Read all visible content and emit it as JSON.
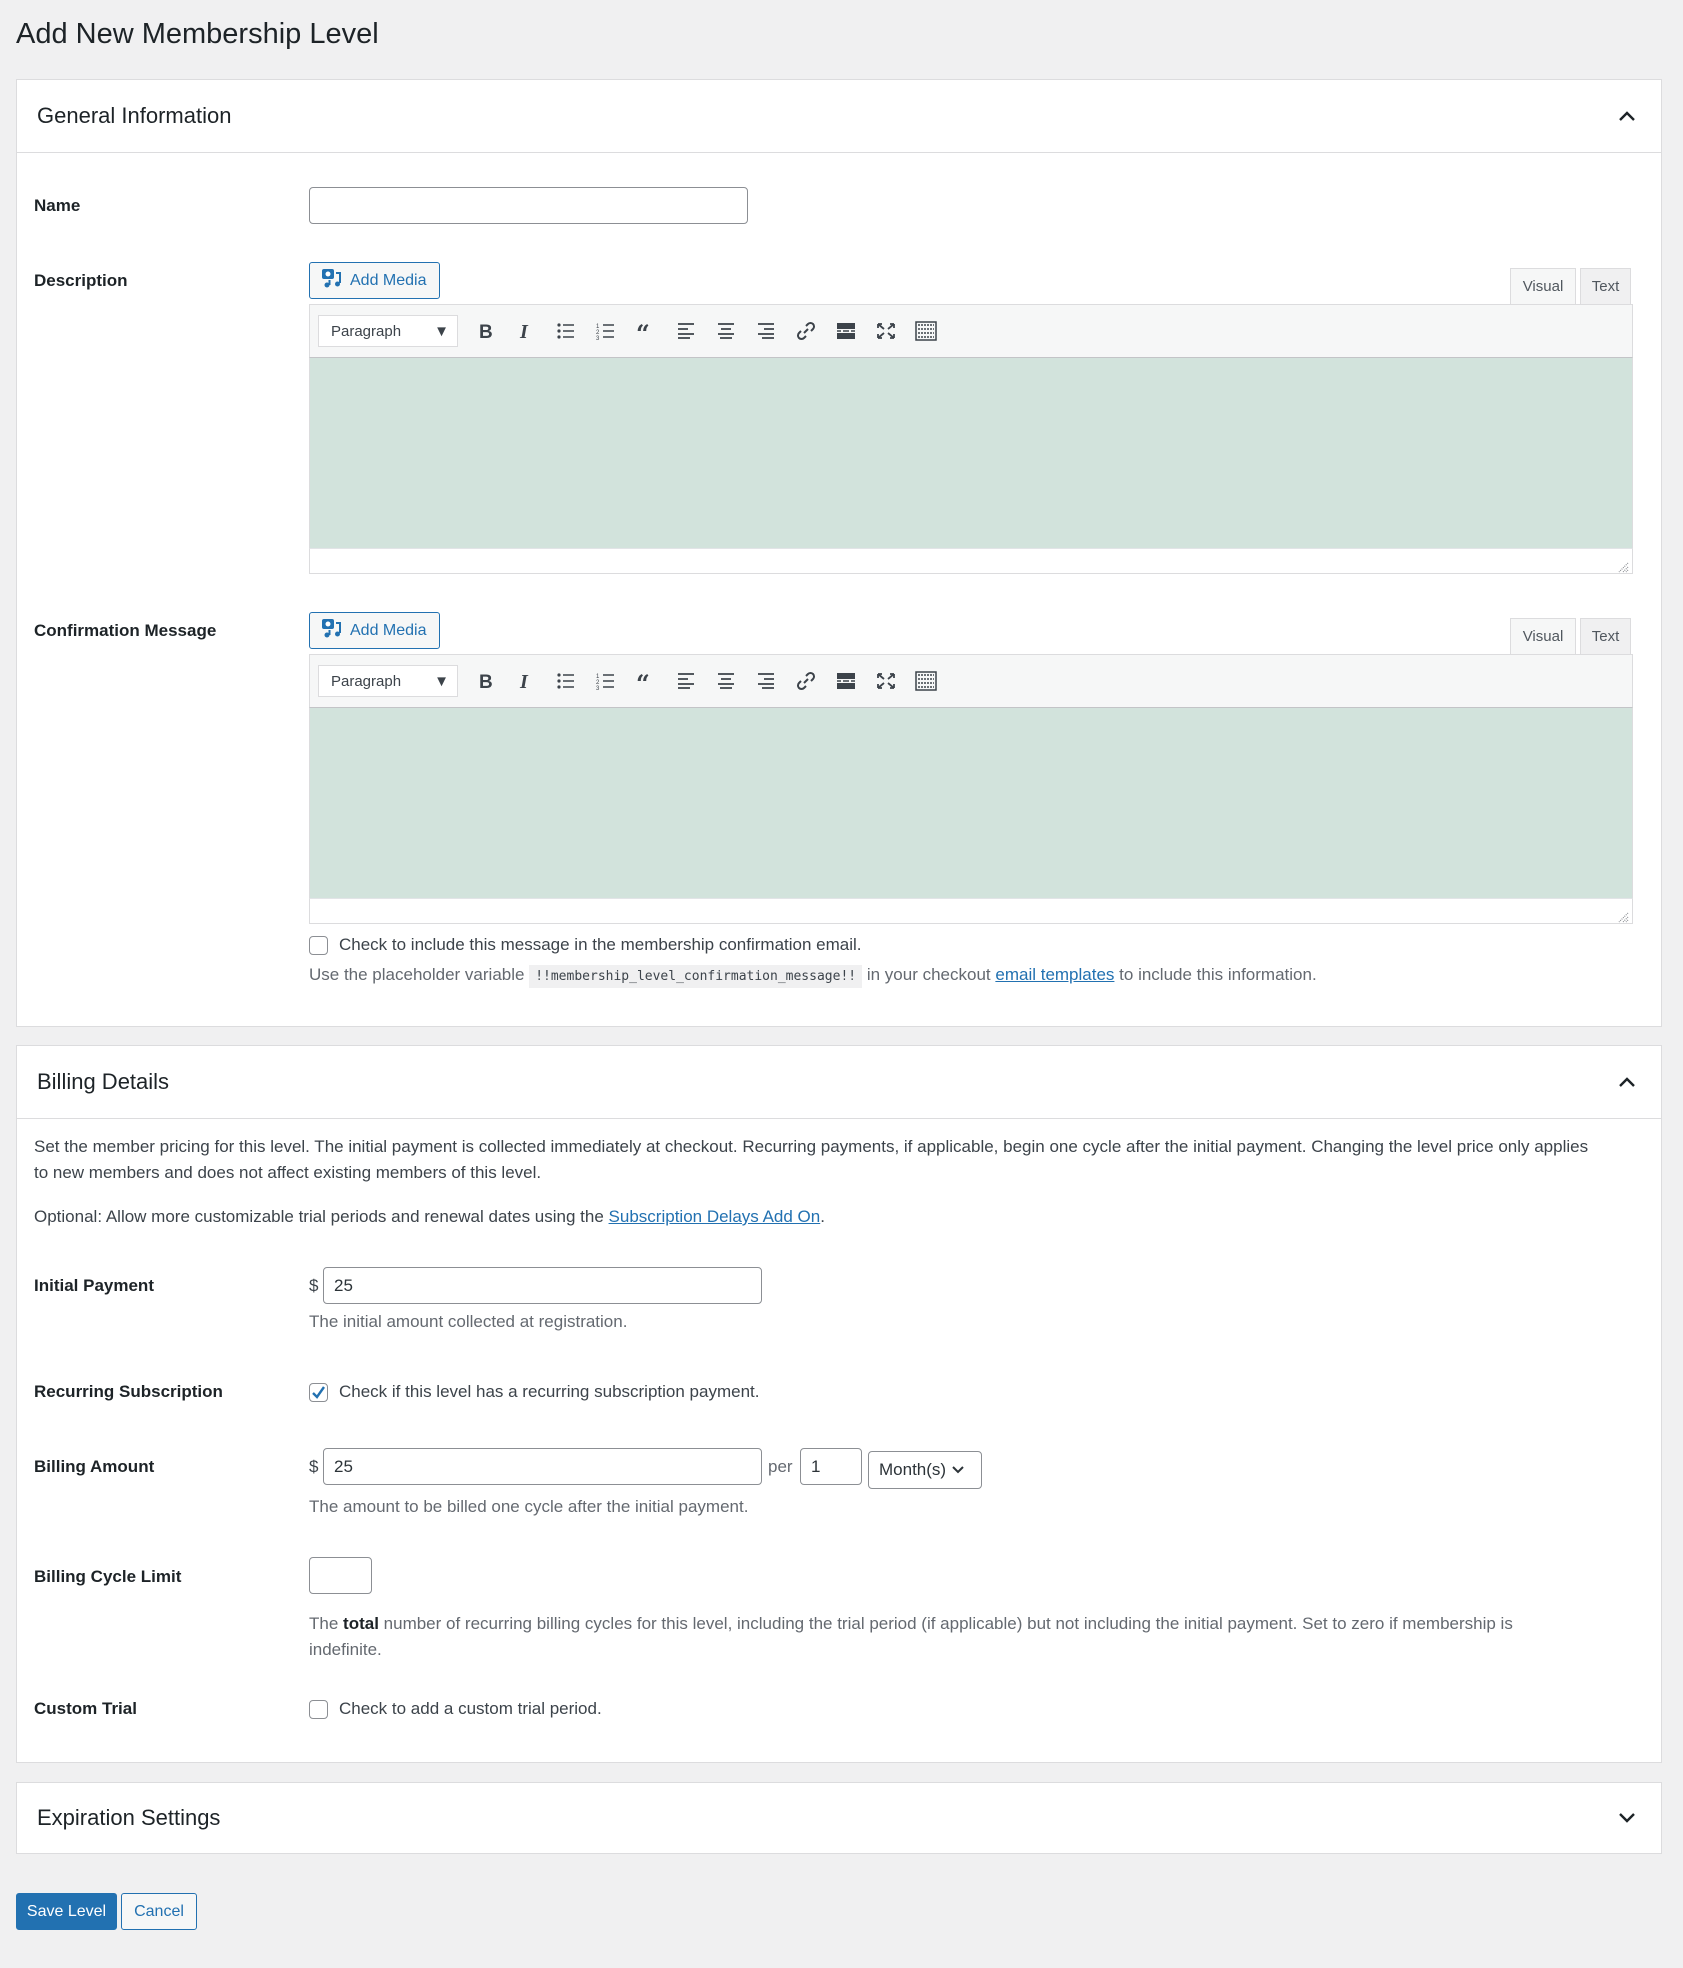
{
  "page": {
    "title": "Add New Membership Level"
  },
  "general": {
    "title": "General Information",
    "name_label": "Name",
    "name_value": "",
    "description_label": "Description",
    "confirmation_label": "Confirmation Message",
    "add_media_label": "Add Media",
    "tab_visual": "Visual",
    "tab_text": "Text",
    "format_select": "Paragraph",
    "toolbar_icons": [
      "bold-icon",
      "italic-icon",
      "bulleted-list-icon",
      "numbered-list-icon",
      "blockquote-icon",
      "align-left-icon",
      "align-center-icon",
      "align-right-icon",
      "link-icon",
      "read-more-icon",
      "fullscreen-icon",
      "toolbar-toggle-icon"
    ],
    "confirm_email_checkbox_label": "Check to include this message in the membership confirmation email.",
    "confirm_email_checked": false,
    "placeholder_prefix": "Use the placeholder variable",
    "placeholder_code": "!!membership_level_confirmation_message!!",
    "placeholder_middle": "in your checkout",
    "placeholder_link": "email templates",
    "placeholder_suffix": "to include this information."
  },
  "billing": {
    "title": "Billing Details",
    "intro_line1": "Set the member pricing for this level. The initial payment is collected immediately at checkout. Recurring payments, if applicable, begin one cycle after the initial payment. Changing the level price only applies",
    "intro_line2": "to new members and does not affect existing members of this level.",
    "optional_prefix": "Optional: Allow more customizable trial periods and renewal dates using the",
    "optional_link": "Subscription Delays Add On",
    "optional_suffix": ".",
    "currency_symbol": "$",
    "initial_payment_label": "Initial Payment",
    "initial_payment_value": "25",
    "initial_payment_desc": "The initial amount collected at registration.",
    "recurring_label": "Recurring Subscription",
    "recurring_checked": true,
    "recurring_checkbox_label": "Check if this level has a recurring subscription payment.",
    "billing_amount_label": "Billing Amount",
    "billing_amount_value": "25",
    "per_label": "per",
    "cycle_number": "1",
    "cycle_period": "Month(s)",
    "billing_amount_desc": "The amount to be billed one cycle after the initial payment.",
    "cycle_limit_label": "Billing Cycle Limit",
    "cycle_limit_value": "",
    "cycle_limit_desc_the": "The",
    "cycle_limit_desc_bold": "total",
    "cycle_limit_desc_line1": "number of recurring billing cycles for this level, including the trial period (if applicable) but not including the initial payment. Set to zero if membership is",
    "cycle_limit_desc_line2": "indefinite.",
    "custom_trial_label": "Custom Trial",
    "custom_trial_checked": false,
    "custom_trial_checkbox_label": "Check to add a custom trial period."
  },
  "expiration": {
    "title": "Expiration Settings"
  },
  "actions": {
    "save_label": "Save Level",
    "cancel_label": "Cancel"
  }
}
